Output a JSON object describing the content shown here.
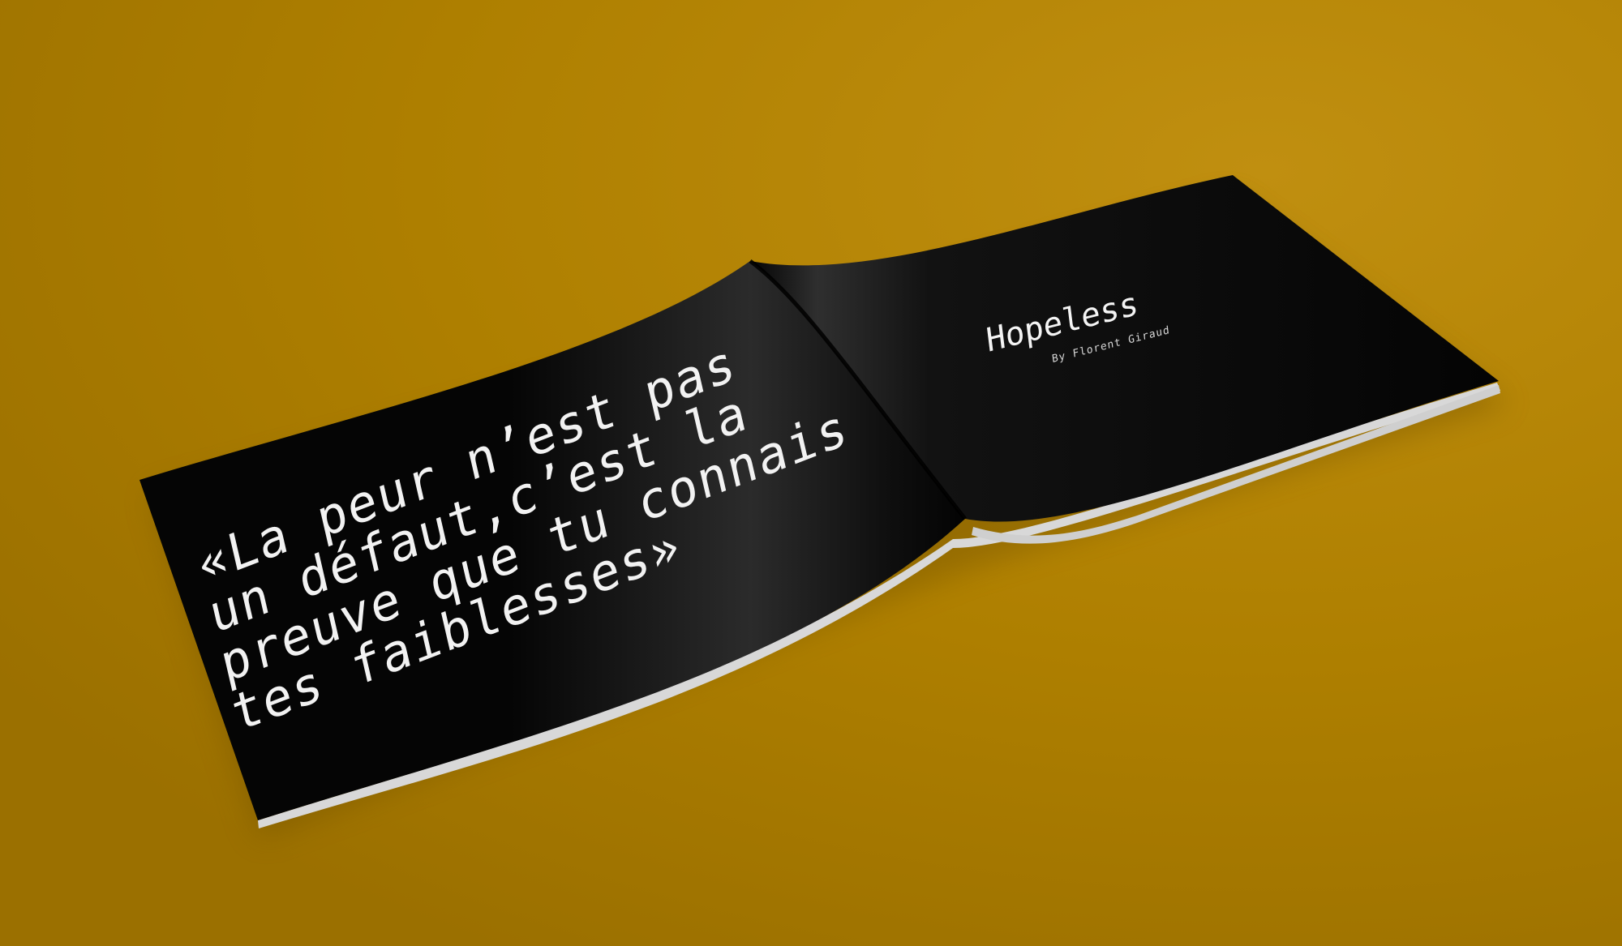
{
  "scene": {
    "background_color": "#b08200",
    "booklet_color": "#050505",
    "page_edge_color": "#d9d9d9",
    "text_color": "#f2f2f2"
  },
  "booklet": {
    "left_page": {
      "quote_lines": [
        "«La peur n’est pas",
        "un défaut,c’est la",
        "preuve que tu connais",
        "tes faiblesses»"
      ]
    },
    "right_page": {
      "title": "Hopeless",
      "author": "By Florent Giraud"
    }
  }
}
